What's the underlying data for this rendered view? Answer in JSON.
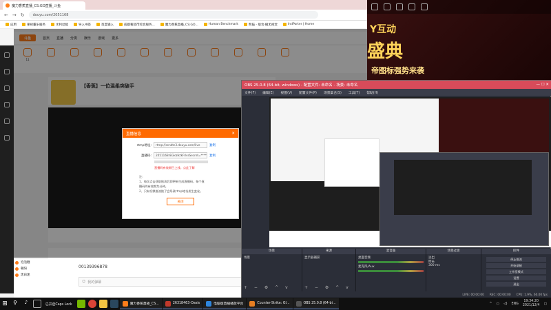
{
  "chrome": {
    "tab_title": "魔力香蕉直播_CS:GO直播_斗鱼",
    "url": "douyu.com/2051168",
    "bookmarks": [
      "应用",
      "果树董乐服务",
      "水利动能",
      "导入书签",
      "百度输入",
      "成都看团市综合服务...",
      "魔力香蕉直播_CS:GO...",
      "Human Benchmark",
      "熊猫 - 联合·播尤视觉",
      "IndPorter | Home"
    ]
  },
  "douyu": {
    "logo": "斗鱼",
    "nav": [
      "首页",
      "直播",
      "分类",
      "娱乐",
      "游戏",
      "更多"
    ],
    "categories": [
      "11",
      "",
      "",
      "",
      "",
      "",
      "",
      "",
      "",
      "",
      "",
      ""
    ],
    "room_title": "【香蕉】一位温柔突破手",
    "chat_list": [
      {
        "name": "泡泡糖"
      },
      {
        "name": "朝阳"
      },
      {
        "name": "黑白迷"
      }
    ],
    "user_id": "00139396878",
    "chat_placeholder": "我的弹幕",
    "send_label": "查看"
  },
  "modal": {
    "title": "直播信息",
    "rtmp_label": "rtmp地址:",
    "rtmp_value": "rtmp://sendtc3.douyu.com/live",
    "code_label": "直播码:",
    "code_value": "2051168rEGkblktkFrlvsSecret=**********",
    "copy_label": "复制",
    "warning": "直播码有效期已上线，点此了解",
    "notes": [
      "注:",
      "1、每次点击获取推流后即更新生成直播码，每个直",
      "播码的有效期为分钟。",
      "2、只有切换推流推了会导致rtmp地址发生变化。"
    ],
    "close_label": "关闭"
  },
  "banner": {
    "line1": "Y互动",
    "line2": "盛典",
    "line3": "帝图标强势来袭"
  },
  "obs": {
    "title": "OBS 25.0.8 (64-bit, windows) - 配置文件: 未命名 - 场景: 未命名",
    "menu": [
      "文件(F)",
      "编辑(E)",
      "视图(V)",
      "配置文件(P)",
      "场景集合(S)",
      "工具(T)",
      "帮助(H)"
    ],
    "docks": [
      {
        "title": "场景",
        "items": [
          "场景"
        ]
      },
      {
        "title": "来源",
        "items": [
          "显示器捕获"
        ]
      },
      {
        "title": "混音器",
        "items": [
          "桌面音频",
          "麦克风/Aux"
        ]
      },
      {
        "title": "场景过渡",
        "items": [
          "淡出",
          "时长",
          "300 ms"
        ]
      },
      {
        "title": "控件",
        "items": [
          "停止推流",
          "开始录制",
          "工作室模式",
          "设置",
          "退出"
        ]
      }
    ],
    "status": [
      "LIVE: 00:00:00",
      "REC: 00:00:00",
      "CPU: 1.9%, 60.00 fps"
    ]
  },
  "taskbar": {
    "search_placeholder": "已开启Caps Lock",
    "apps": [
      {
        "label": "魔力香蕉直播_CS...",
        "color": "#ff7d1a"
      },
      {
        "label": "26318463-Oasis",
        "color": "#c0392b"
      },
      {
        "label": "电脑版直播播放平台",
        "color": "#2e86de"
      },
      {
        "label": "Counter-Strike: Gl...",
        "color": "#e67e22"
      },
      {
        "label": "OBS 25.0.8 (64-bi...",
        "color": "#555555"
      }
    ],
    "lang": "ENG",
    "time": "19:34:20",
    "date": "2021/12/4"
  }
}
